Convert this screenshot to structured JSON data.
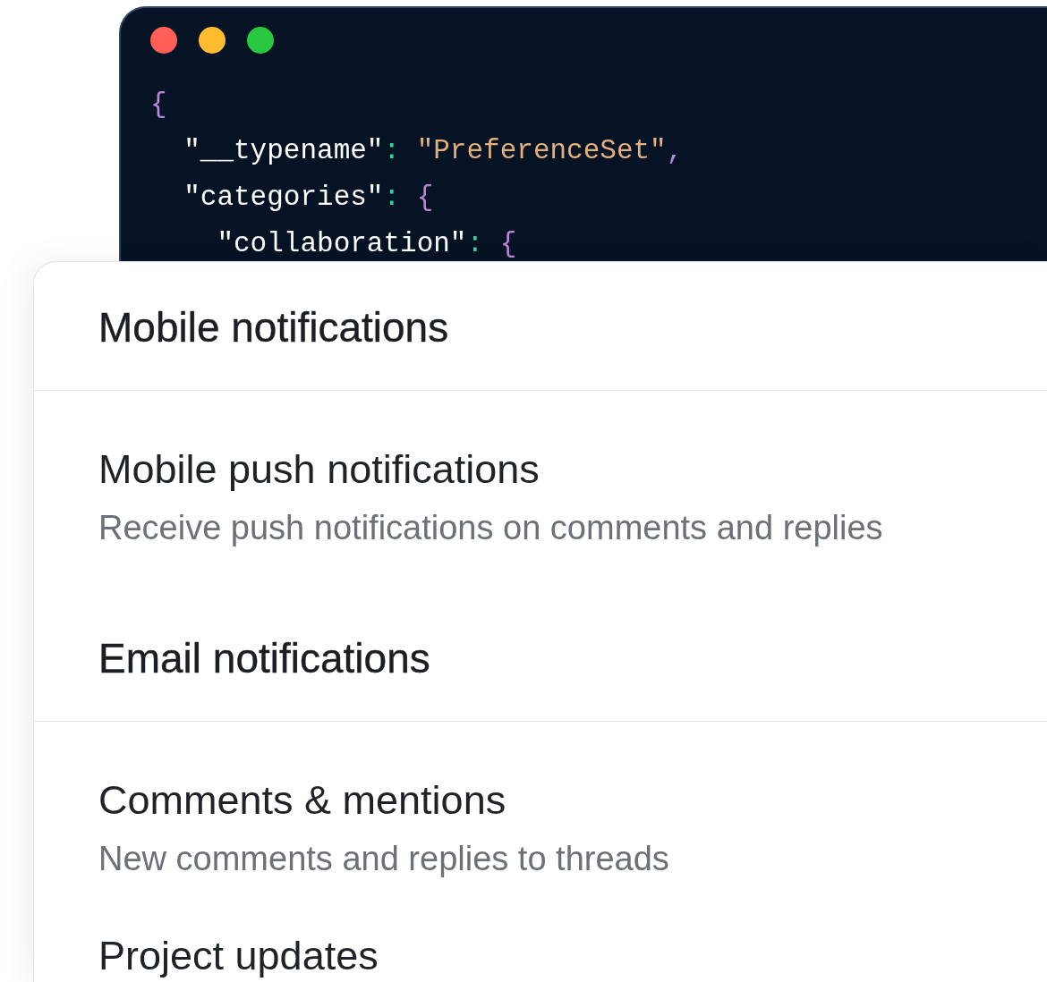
{
  "window": {
    "controls": [
      {
        "kind": "close"
      },
      {
        "kind": "minimize"
      },
      {
        "kind": "zoom"
      }
    ]
  },
  "code": {
    "lines": [
      {
        "tokens": [
          {
            "kind": "brace",
            "text": "{"
          }
        ],
        "children": [
          {
            "tokens": [
              {
                "kind": "key",
                "text": "\"__typename\""
              },
              {
                "kind": "colon",
                "text": ":"
              },
              {
                "kind": "string",
                "text": "\"PreferenceSet\""
              },
              {
                "kind": "comma",
                "text": ","
              }
            ]
          },
          {
            "tokens": [
              {
                "kind": "key",
                "text": "\"categories\""
              },
              {
                "kind": "colon",
                "text": ":"
              },
              {
                "kind": "brace",
                "text": "{"
              }
            ],
            "children": [
              {
                "tokens": [
                  {
                    "kind": "key",
                    "text": "\"collaboration\""
                  },
                  {
                    "kind": "colon",
                    "text": ":"
                  },
                  {
                    "kind": "brace",
                    "text": "{"
                  }
                ]
              }
            ]
          }
        ]
      }
    ]
  },
  "settings": {
    "sections": [
      {
        "title": "Mobile notifications",
        "items": [
          {
            "title": "Mobile push notifications",
            "description": "Receive push notifications on comments and replies"
          }
        ]
      },
      {
        "title": "Email notifications",
        "items": [
          {
            "title": "Comments & mentions",
            "description": "New comments and replies to threads"
          },
          {
            "title": "Project updates"
          }
        ]
      }
    ]
  }
}
